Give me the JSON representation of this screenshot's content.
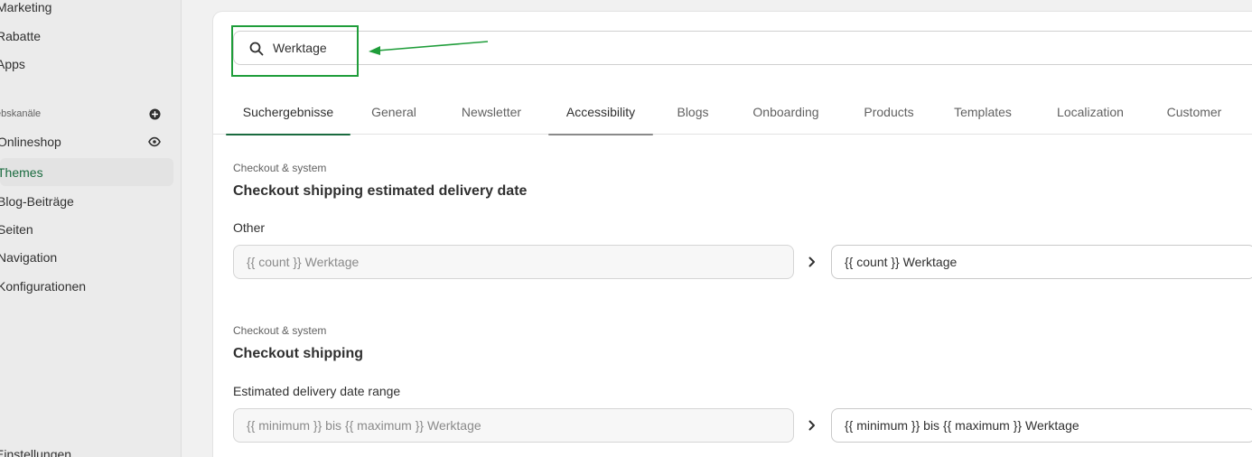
{
  "sidebar": {
    "top_items": [
      "Marketing",
      "Rabatte",
      "Apps"
    ],
    "section_label": "ebskanäle",
    "section_icon": "plus-circle-icon",
    "onlineshop": {
      "label": "Onlineshop",
      "icon": "eye-icon"
    },
    "sub_items": [
      "Themes",
      "Blog-Beiträge",
      "Seiten",
      "Navigation",
      "Konfigurationen"
    ],
    "active_item": "Themes",
    "bottom_item": "Einstellungen"
  },
  "search": {
    "icon": "search-icon",
    "value": "Werktage"
  },
  "annotation": {
    "arrow_color": "#1f9d3a",
    "highlight_color": "#1f9d3a"
  },
  "tabs": [
    "Suchergebnisse",
    "General",
    "Newsletter",
    "Accessibility",
    "Blogs",
    "Onboarding",
    "Products",
    "Templates",
    "Localization",
    "Customer"
  ],
  "selected_tab": "Suchergebnisse",
  "results": [
    {
      "category": "Checkout & system",
      "title": "Checkout shipping estimated delivery date",
      "field_label": "Other",
      "source": "{{ count }} Werktage",
      "target": "{{ count }} Werktage"
    },
    {
      "category": "Checkout & system",
      "title": "Checkout shipping",
      "field_label": "Estimated delivery date range",
      "source": "{{ minimum }} bis {{ maximum }} Werktage",
      "target": "{{ minimum }} bis {{ maximum }} Werktage"
    }
  ],
  "colors": {
    "accent_green": "#1a6b3f",
    "tab_underline_selected": "#1a6b3f",
    "tab_underline_hover": "#8a8a8a"
  }
}
